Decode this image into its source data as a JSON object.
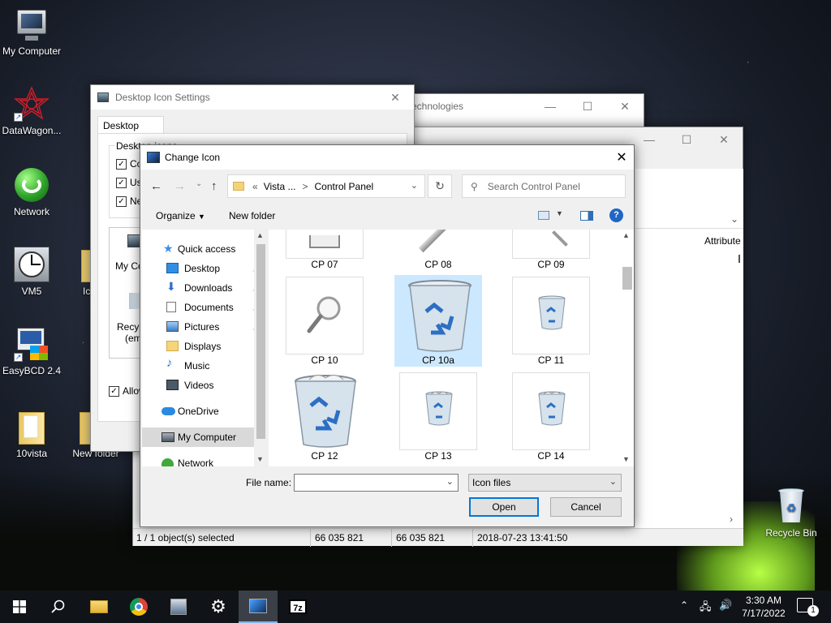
{
  "desktop": {
    "icons": [
      {
        "label": "My Computer"
      },
      {
        "label": "DataWagon..."
      },
      {
        "label": "Network"
      },
      {
        "label": "VM5"
      },
      {
        "label": "EasyBCD 2.4"
      },
      {
        "label": "10vista"
      },
      {
        "label": "Ic"
      },
      {
        "label": "New folder"
      },
      {
        "label": "Recycle Bin"
      }
    ]
  },
  "dis": {
    "title": "Desktop Icon Settings",
    "tab": "Desktop Icons",
    "group": "Desktop icons",
    "checks": [
      "Cor",
      "Use",
      "Net"
    ],
    "list": [
      "My Cor",
      "Recyc",
      "(emp"
    ],
    "allow": "Allow"
  },
  "bgwin": {
    "title": "echnologies",
    "attribute": "Attribute",
    "status": {
      "selected": "1 / 1 object(s) selected",
      "size1": "66 035 821",
      "size2": "66 035 821",
      "date": "2018-07-23 13:41:50"
    }
  },
  "dialog": {
    "title": "Change Icon",
    "breadcrumb": {
      "overflow": "«",
      "parent": "Vista ...",
      "sep": ">",
      "current": "Control Panel"
    },
    "search_placeholder": "Search Control Panel",
    "organize": "Organize",
    "new_folder": "New folder",
    "nav": [
      {
        "label": "Quick access",
        "icon": "star-icon"
      },
      {
        "label": "Desktop",
        "icon": "desktop-icon",
        "pinned": true
      },
      {
        "label": "Downloads",
        "icon": "downloads-icon",
        "pinned": true
      },
      {
        "label": "Documents",
        "icon": "documents-icon",
        "pinned": true
      },
      {
        "label": "Pictures",
        "icon": "pictures-icon",
        "pinned": true
      },
      {
        "label": "Displays",
        "icon": "folder-icon"
      },
      {
        "label": "Music",
        "icon": "music-icon"
      },
      {
        "label": "Videos",
        "icon": "videos-icon"
      },
      {
        "label": "OneDrive",
        "icon": "onedrive-icon"
      },
      {
        "label": "My Computer",
        "icon": "computer-icon"
      },
      {
        "label": "Network",
        "icon": "network-icon"
      }
    ],
    "tiles": [
      "CP 07",
      "CP 08",
      "CP 09",
      "CP 10",
      "CP 10a",
      "CP 11",
      "CP 12",
      "CP 13",
      "CP 14"
    ],
    "selected_tile": "CP 10a",
    "file_name_label": "File name:",
    "file_name_value": "",
    "filter": "Icon files",
    "open": "Open",
    "cancel": "Cancel"
  },
  "taskbar": {
    "time": "3:30 AM",
    "date": "7/17/2022",
    "notifications": "1"
  }
}
